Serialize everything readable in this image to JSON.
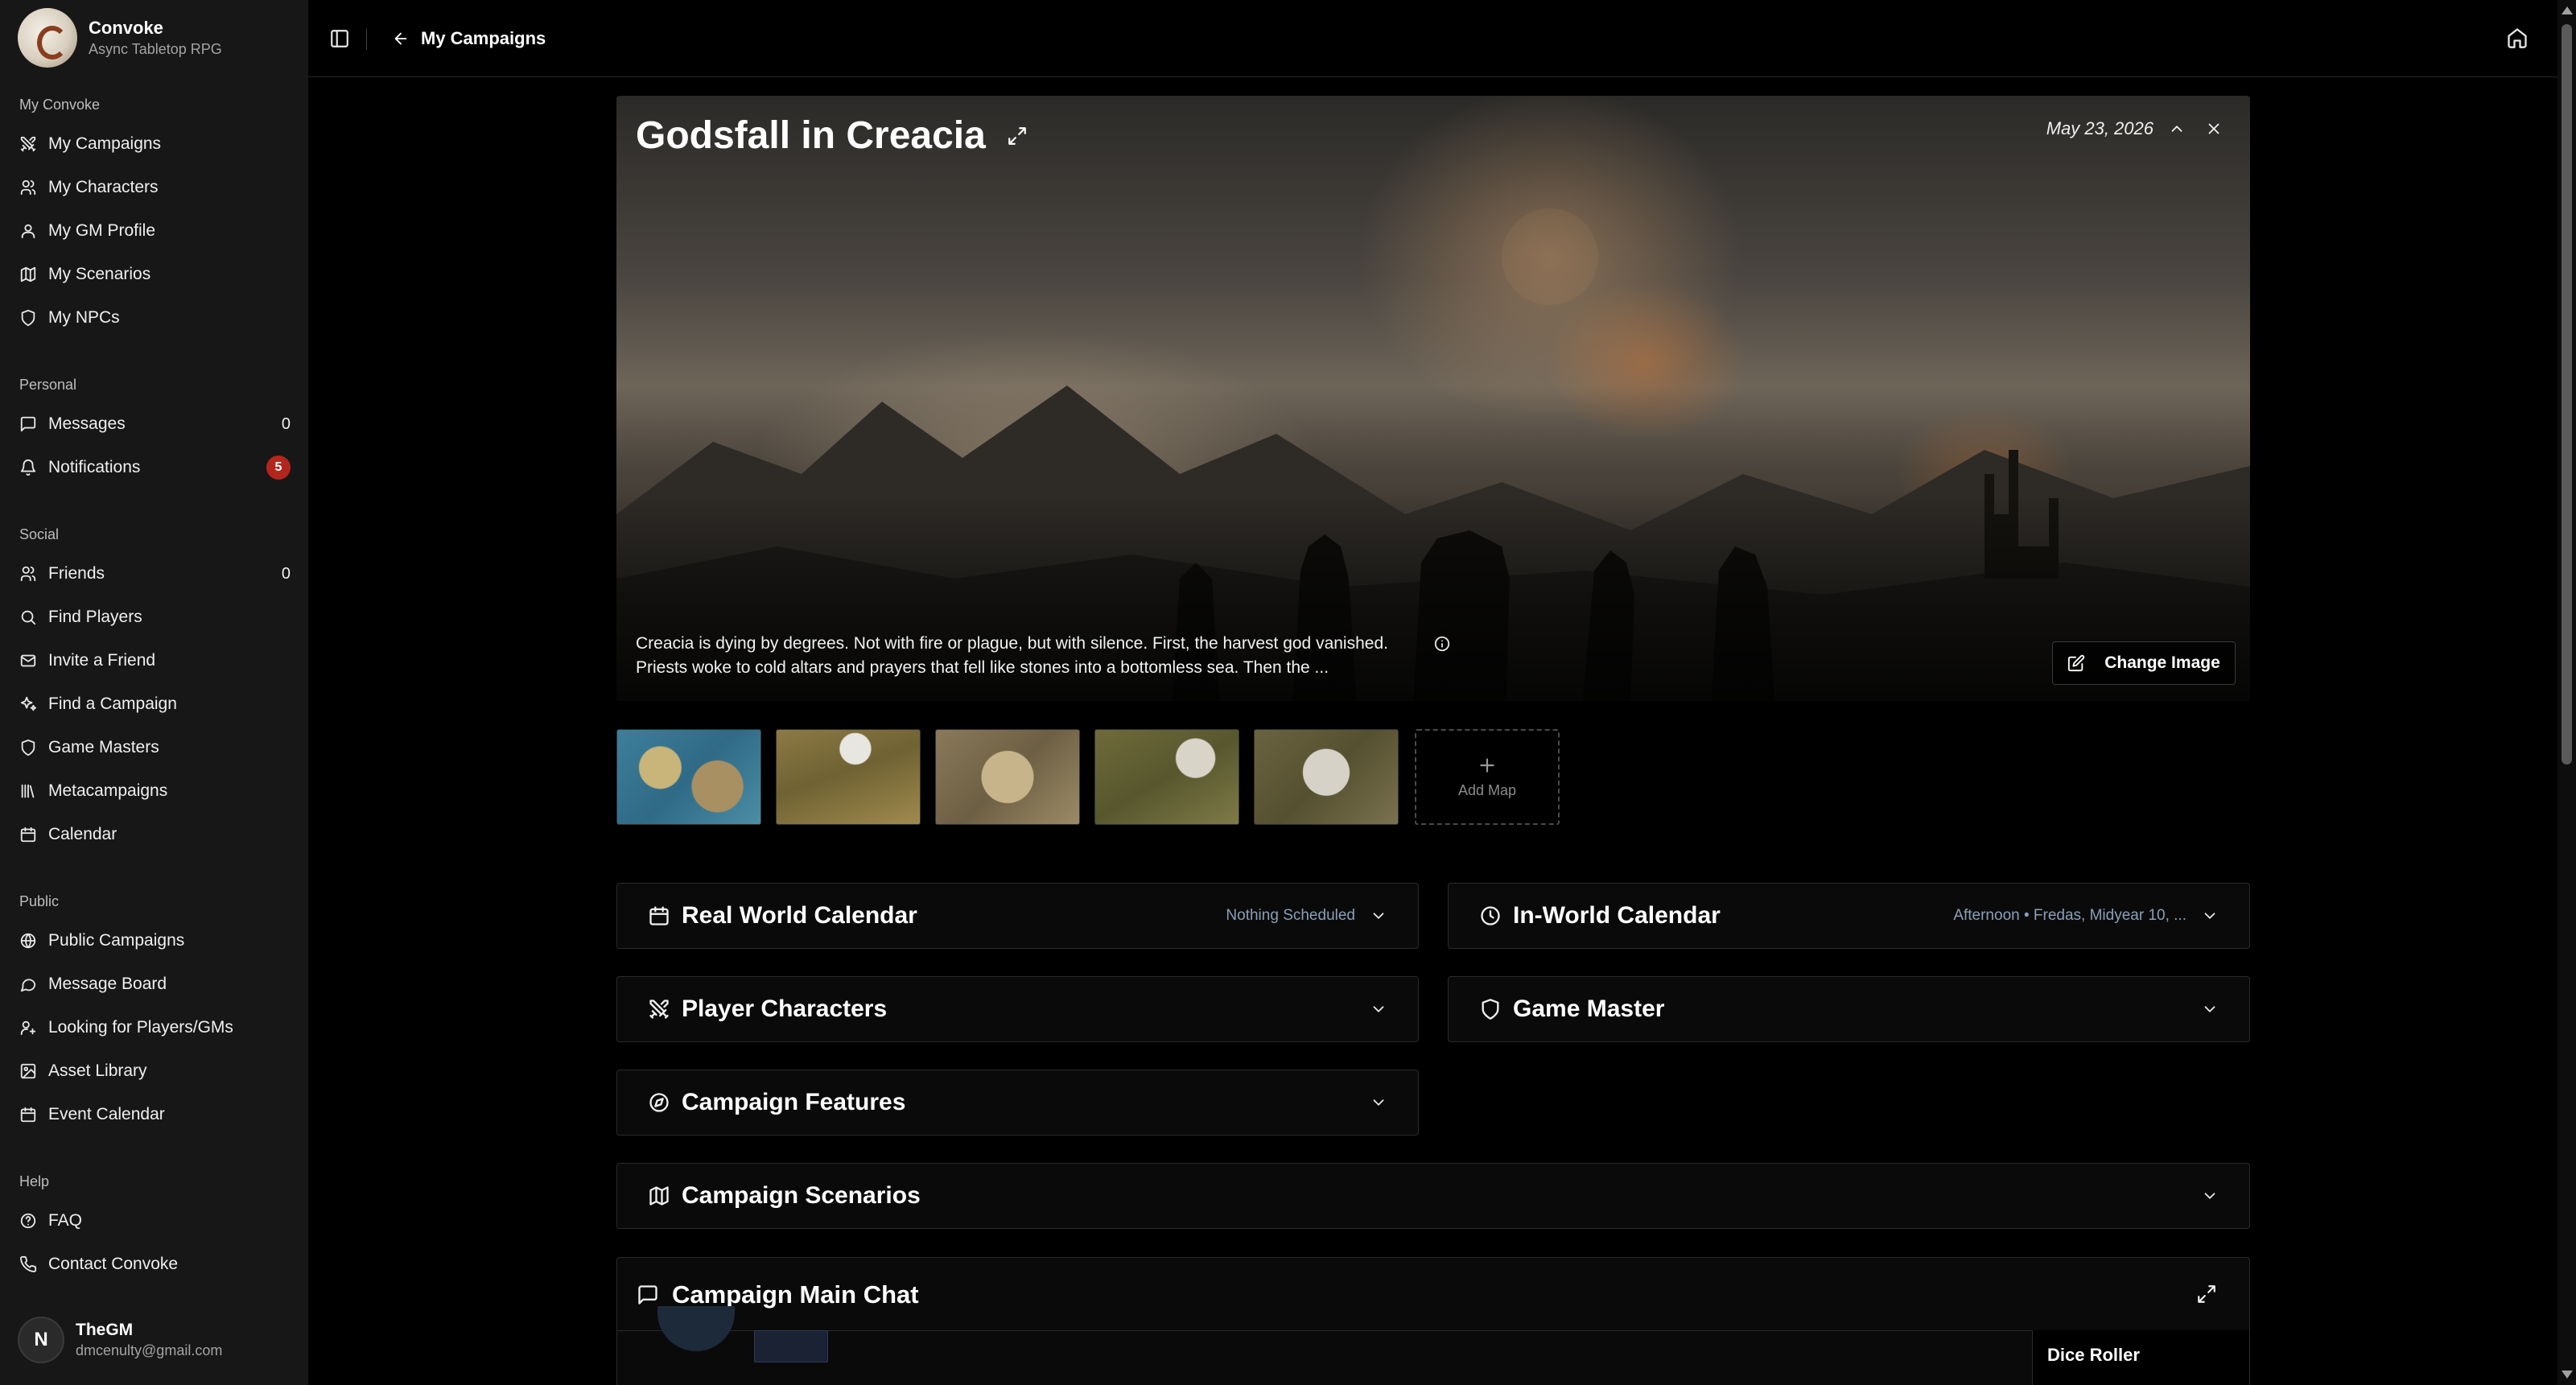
{
  "brand": {
    "name": "Convoke",
    "subtitle": "Async Tabletop RPG"
  },
  "sidebar": {
    "sections": [
      {
        "label": "My Convoke",
        "items": [
          {
            "label": "My Campaigns",
            "icon": "swords-icon"
          },
          {
            "label": "My Characters",
            "icon": "users-icon"
          },
          {
            "label": "My GM Profile",
            "icon": "user-icon"
          },
          {
            "label": "My Scenarios",
            "icon": "map-icon"
          },
          {
            "label": "My NPCs",
            "icon": "shield-icon"
          }
        ]
      },
      {
        "label": "Personal",
        "items": [
          {
            "label": "Messages",
            "icon": "message-icon",
            "count": "0"
          },
          {
            "label": "Notifications",
            "icon": "bell-icon",
            "badge": "5"
          }
        ]
      },
      {
        "label": "Social",
        "items": [
          {
            "label": "Friends",
            "icon": "users-icon",
            "count": "0"
          },
          {
            "label": "Find Players",
            "icon": "search-icon"
          },
          {
            "label": "Invite a Friend",
            "icon": "mail-icon"
          },
          {
            "label": "Find a Campaign",
            "icon": "sparkles-icon"
          },
          {
            "label": "Game Masters",
            "icon": "shield-icon"
          },
          {
            "label": "Metacampaigns",
            "icon": "library-icon"
          },
          {
            "label": "Calendar",
            "icon": "calendar-icon"
          }
        ]
      },
      {
        "label": "Public",
        "items": [
          {
            "label": "Public Campaigns",
            "icon": "globe-icon"
          },
          {
            "label": "Message Board",
            "icon": "message-icon"
          },
          {
            "label": "Looking for Players/GMs",
            "icon": "user-plus-icon"
          },
          {
            "label": "Asset Library",
            "icon": "image-icon"
          },
          {
            "label": "Event Calendar",
            "icon": "calendar-icon"
          }
        ]
      },
      {
        "label": "Help",
        "items": [
          {
            "label": "FAQ",
            "icon": "help-circle-icon"
          },
          {
            "label": "Contact Convoke",
            "icon": "phone-icon"
          }
        ]
      }
    ]
  },
  "user": {
    "initial": "N",
    "name": "TheGM",
    "email": "dmcenulty@gmail.com"
  },
  "topbar": {
    "back_label": "My Campaigns"
  },
  "campaign": {
    "title": "Godsfall in Creacia",
    "date": "May 23, 2026",
    "description_line1": "Creacia is dying by degrees. Not with fire or plague, but with silence. First, the harvest god vanished.",
    "description_line2": "Priests woke to cold altars and prayers that fell like stones into a bottomless sea. Then the ...",
    "change_image_label": "Change Image",
    "add_map_label": "Add Map",
    "map_count": 5
  },
  "panels": {
    "real_world_calendar": {
      "title": "Real World Calendar",
      "status": "Nothing Scheduled"
    },
    "in_world_calendar": {
      "title": "In-World Calendar",
      "status": "Afternoon • Fredas, Midyear 10, ..."
    },
    "player_characters": {
      "title": "Player Characters"
    },
    "game_master": {
      "title": "Game Master"
    },
    "campaign_features": {
      "title": "Campaign Features"
    },
    "campaign_scenarios": {
      "title": "Campaign Scenarios"
    }
  },
  "chat": {
    "title": "Campaign Main Chat",
    "dice_roller_label": "Dice Roller"
  },
  "colors": {
    "badge": "#b3261e",
    "status_text": "#8aa0b8",
    "background": "#000000",
    "sidebar": "#171717"
  }
}
